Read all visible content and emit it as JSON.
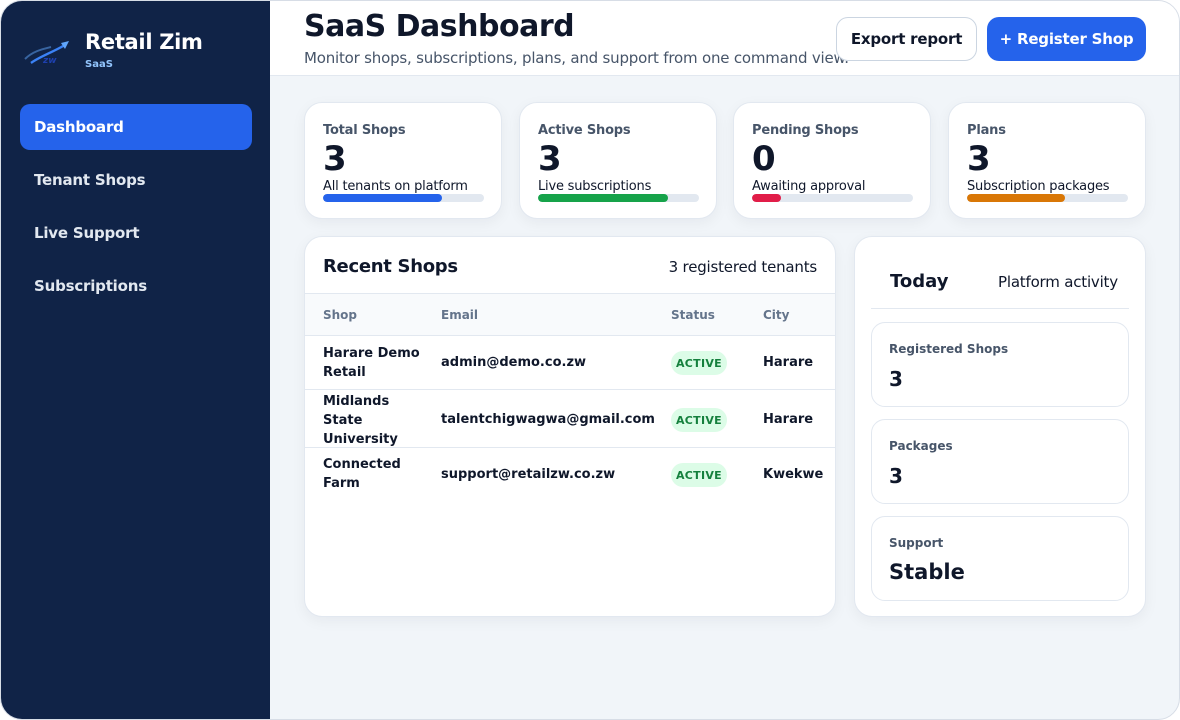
{
  "brand": {
    "title": "Retail Zim",
    "subtitle": "SaaS"
  },
  "sidebar": {
    "items": [
      {
        "label": "Dashboard",
        "active": true
      },
      {
        "label": "Tenant Shops",
        "active": false
      },
      {
        "label": "Live Support",
        "active": false
      },
      {
        "label": "Subscriptions",
        "active": false
      }
    ]
  },
  "header": {
    "title": "SaaS Dashboard",
    "subtitle": "Monitor shops, subscriptions, plans, and support from one command view.",
    "export_label": "Export report",
    "register_label": "+ Register Shop"
  },
  "stats": [
    {
      "label": "Total Shops",
      "value": "3",
      "desc": "All tenants on platform",
      "progress": 0.74,
      "color": "#2563eb"
    },
    {
      "label": "Active Shops",
      "value": "3",
      "desc": "Live subscriptions",
      "progress": 0.81,
      "color": "#16a34a"
    },
    {
      "label": "Pending Shops",
      "value": "0",
      "desc": "Awaiting approval",
      "progress": 0.18,
      "color": "#e11d48"
    },
    {
      "label": "Plans",
      "value": "3",
      "desc": "Subscription packages",
      "progress": 0.61,
      "color": "#d97706"
    }
  ],
  "recent_shops": {
    "title": "Recent Shops",
    "meta": "3 registered tenants",
    "columns": [
      "Shop",
      "Email",
      "Status",
      "City"
    ],
    "rows": [
      {
        "shop": "Harare Demo Retail",
        "email": "admin@demo.co.zw",
        "status": "ACTIVE",
        "city": "Harare"
      },
      {
        "shop": "Midlands State University",
        "email": "talentchigwagwa@gmail.com",
        "status": "ACTIVE",
        "city": "Harare"
      },
      {
        "shop": "Connected Farm",
        "email": "support@retailzw.co.zw",
        "status": "ACTIVE",
        "city": "Kwekwe"
      }
    ]
  },
  "today": {
    "title": "Today",
    "meta": "Platform activity",
    "metrics": [
      {
        "label": "Registered Shops",
        "value": "3"
      },
      {
        "label": "Packages",
        "value": "3"
      },
      {
        "label": "Support",
        "value": "Stable"
      }
    ]
  },
  "colors": {
    "sidebar": "#102347",
    "accent": "#2563eb",
    "active_badge_bg": "#dcfce7",
    "active_badge_text": "#15803d"
  }
}
